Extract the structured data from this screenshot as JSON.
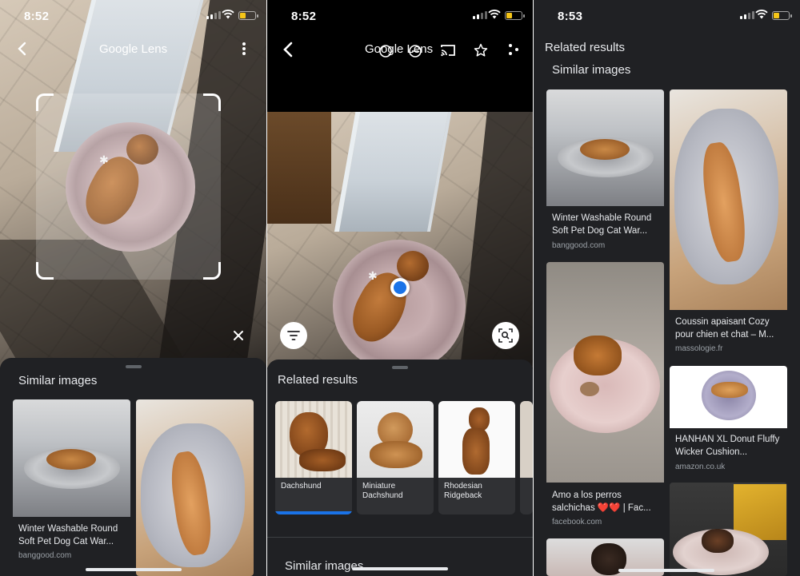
{
  "colors": {
    "background": "#202124",
    "accent": "#1a73e8",
    "text": "#e8eaed",
    "muted": "#9aa0a6"
  },
  "screen1": {
    "status_time": "8:52",
    "app_title": "Google Lens",
    "sheet_title": "Similar images",
    "results": [
      {
        "caption": "Winter Washable Round Soft Pet Dog Cat War...",
        "source": "banggood.com"
      }
    ]
  },
  "screen2": {
    "status_time": "8:52",
    "app_title": "Google Lens",
    "related_title": "Related results",
    "related": [
      {
        "label": "Dachshund"
      },
      {
        "label": "Miniature Dachshund"
      },
      {
        "label": "Rhodesian Ridgeback"
      }
    ],
    "similar_title": "Similar images"
  },
  "screen3": {
    "status_time": "8:53",
    "header": "Related results",
    "similar_title": "Similar images",
    "results": [
      {
        "caption": "Winter Washable Round Soft Pet Dog Cat War...",
        "source": "banggood.com"
      },
      {
        "caption": "Coussin apaisant Cozy pour chien et chat – M...",
        "source": "massologie.fr"
      },
      {
        "caption": "Amo a los perros salchichas ❤️❤️ | Fac...",
        "source": "facebook.com"
      },
      {
        "caption": "HANHAN XL Donut Fluffy Wicker Cushion...",
        "source": "amazon.co.uk"
      }
    ]
  },
  "icons": [
    "back-arrow-icon",
    "more-vert-icon",
    "close-icon",
    "cast-icon",
    "star-icon",
    "share-icon",
    "filter-icon",
    "search-region-icon",
    "flash-icon",
    "lens-icon"
  ]
}
